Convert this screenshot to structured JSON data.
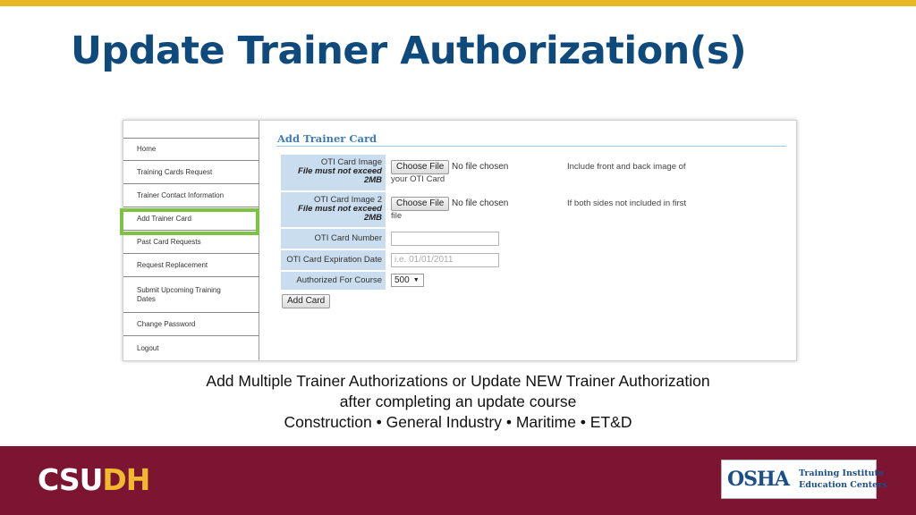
{
  "slide": {
    "title": "Update Trainer Authorization(s)",
    "caption": {
      "line1": "Add Multiple Trainer Authorizations or Update NEW Trainer Authorization",
      "line2": "after completing an update course",
      "line3": "Construction • General Industry • Maritime • ET&D"
    },
    "colors": {
      "accent_bar": "#e8b820",
      "title": "#0f4a7c",
      "footer": "#7b1532",
      "highlight": "#7dc242"
    }
  },
  "sidebar": {
    "items": [
      {
        "label": "Home"
      },
      {
        "label": "Training Cards Request"
      },
      {
        "label": "Trainer Contact Information"
      },
      {
        "label": "Add Trainer Card"
      },
      {
        "label": "Past Card Requests"
      },
      {
        "label": "Request Replacement"
      },
      {
        "label": "Submit Upcoming Training Dates"
      },
      {
        "label": "Change Password"
      },
      {
        "label": "Logout"
      }
    ]
  },
  "form": {
    "heading": "Add Trainer Card",
    "rows": {
      "image1": {
        "label": "OTI Card Image",
        "note": "File must not exceed 2MB",
        "button": "Choose File",
        "status": "No file chosen",
        "hint_a": "Include front and back image of",
        "hint_b": "your OTI Card"
      },
      "image2": {
        "label": "OTI Card Image 2",
        "note": "File must not exceed 2MB",
        "button": "Choose File",
        "status": "No file chosen",
        "hint_a": "If both sides not included in first",
        "hint_b": "file"
      },
      "card_number": {
        "label": "OTI Card Number",
        "value": ""
      },
      "expiration": {
        "label": "OTI Card Expiration Date",
        "placeholder": "i.e. 01/01/2011"
      },
      "course": {
        "label": "Authorized For Course",
        "value": "500"
      }
    },
    "submit": "Add Card"
  },
  "footer": {
    "logo_a": "CSU",
    "logo_b": "DH",
    "partner_word": "OSHA",
    "partner_line1": "Training Institute",
    "partner_line2": "Education Centers"
  }
}
